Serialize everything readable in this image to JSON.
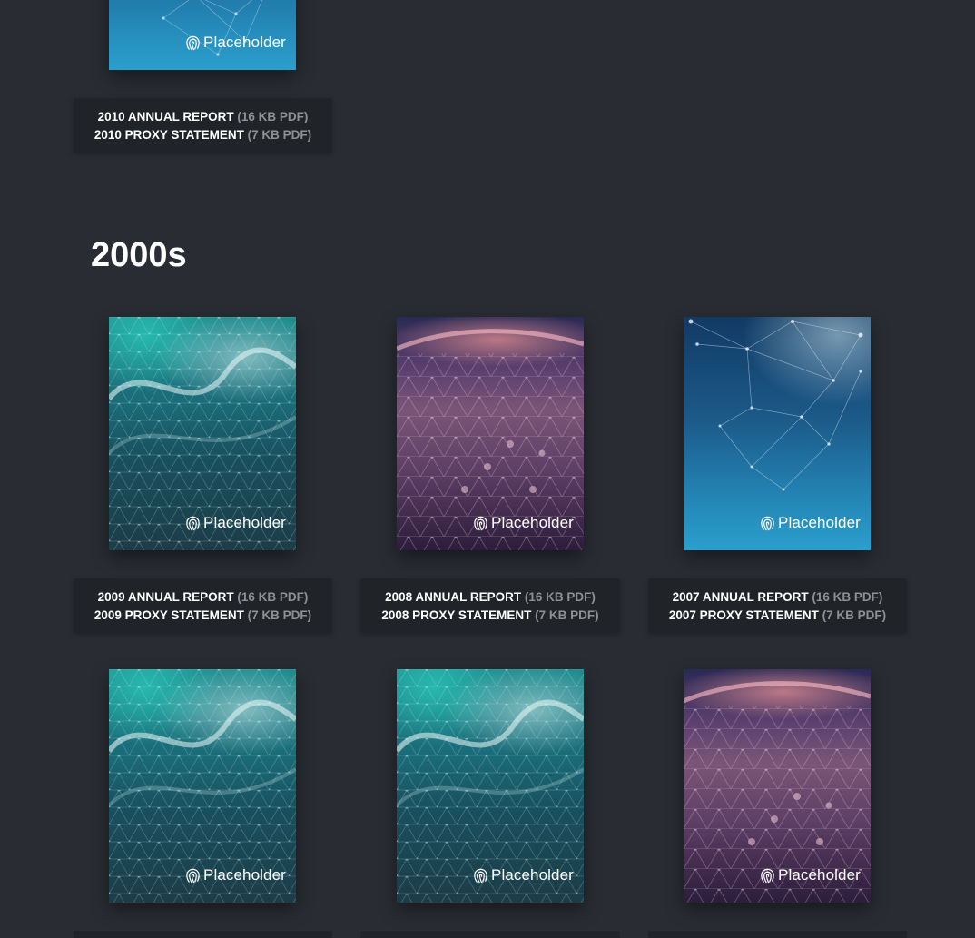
{
  "brand_name": "Placeholder",
  "section_title": "2000s",
  "cards": [
    {
      "annual_label": "2010 ANNUAL REPORT",
      "annual_meta": "(16 KB PDF)",
      "proxy_label": "2010 PROXY STATEMENT",
      "proxy_meta": "(7 KB PDF)",
      "cover_style": "blue"
    },
    {
      "annual_label": "2009 ANNUAL REPORT",
      "annual_meta": "(16 KB PDF)",
      "proxy_label": "2009 PROXY STATEMENT",
      "proxy_meta": "(7 KB PDF)",
      "cover_style": "teal"
    },
    {
      "annual_label": "2008 ANNUAL REPORT",
      "annual_meta": "(16 KB PDF)",
      "proxy_label": "2008 PROXY STATEMENT",
      "proxy_meta": "(7 KB PDF)",
      "cover_style": "purple"
    },
    {
      "annual_label": "2007 ANNUAL REPORT",
      "annual_meta": "(16 KB PDF)",
      "proxy_label": "2007 PROXY STATEMENT",
      "proxy_meta": "(7 KB PDF)",
      "cover_style": "blue"
    },
    {
      "cover_style": "teal"
    },
    {
      "cover_style": "teal"
    },
    {
      "cover_style": "purple"
    }
  ],
  "colors": {
    "page_background": "#292d33",
    "label_background": "#202328",
    "label_text": "#ffffff",
    "meta_text": "#8e9196"
  }
}
